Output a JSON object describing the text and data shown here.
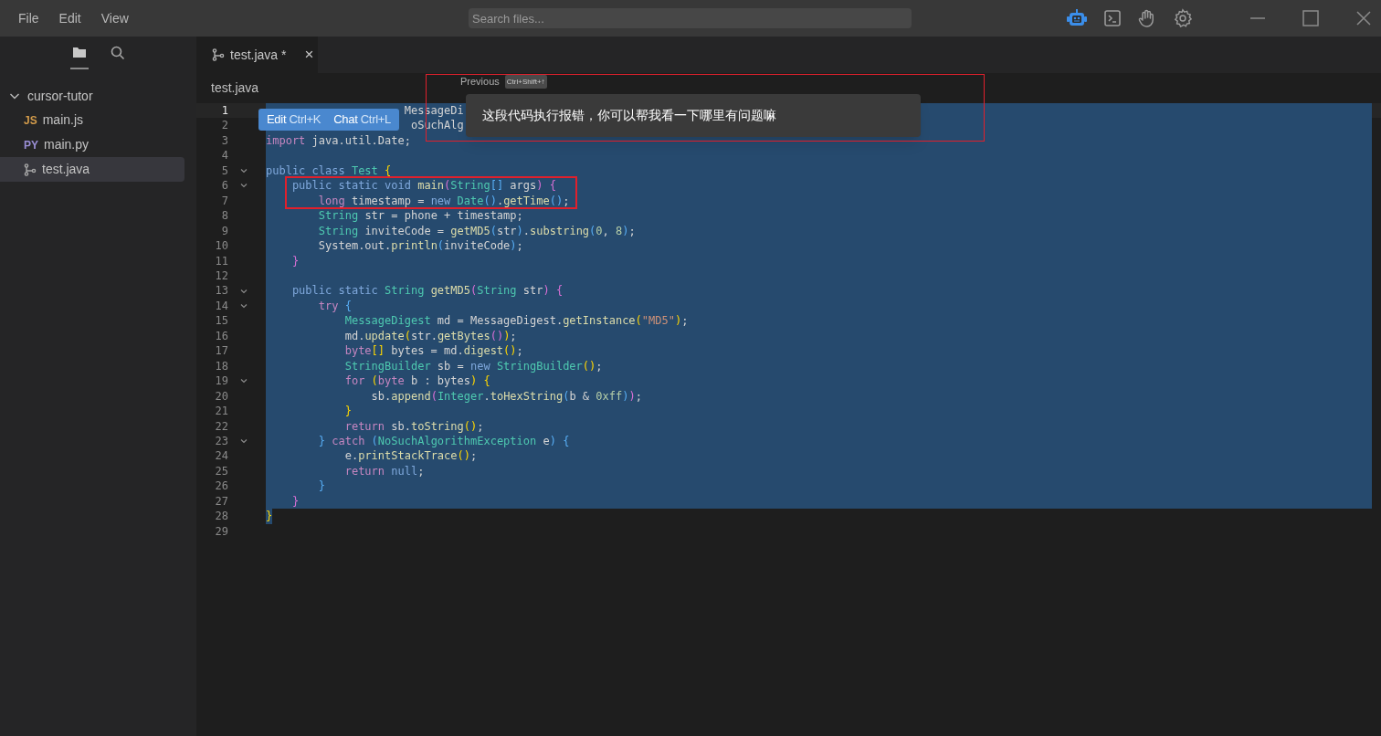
{
  "menu": [
    "File",
    "Edit",
    "View"
  ],
  "search": {
    "placeholder": "Search files..."
  },
  "toolbar": [
    {
      "kind": "robot",
      "selected": true
    },
    {
      "kind": "terminal",
      "selected": false
    },
    {
      "kind": "hand",
      "selected": false
    },
    {
      "kind": "settings",
      "selected": false
    }
  ],
  "sidebar": {
    "tabs": [
      {
        "kind": "files",
        "selected": true
      },
      {
        "kind": "search",
        "selected": false
      }
    ],
    "tree": [
      {
        "name": "cursor-tutor",
        "expanded": true,
        "children": [
          {
            "name": "main.js",
            "kind": "badge",
            "badge": "JS",
            "color": "#d19a4a",
            "selected": false
          },
          {
            "name": "main.py",
            "kind": "badge",
            "badge": "PY",
            "color": "#9a8fd6",
            "selected": false
          },
          {
            "name": "test.java",
            "kind": "java",
            "selected": true
          }
        ]
      }
    ]
  },
  "tab": {
    "label": "test.java *",
    "close": "×"
  },
  "breadcrumb": "test.java",
  "prompt": {
    "previous": "Previous",
    "shortcut": "Ctrl+Shift+↑",
    "value": "这段代码执行报错，你可以帮我看一下哪里有问题嘛"
  },
  "popup": [
    {
      "label": "Edit",
      "shortcut": "Ctrl+K"
    },
    {
      "label": "Chat",
      "shortcut": "Ctrl+L"
    }
  ],
  "lines": [
    {
      "n": "1",
      "active": true,
      "fold": false,
      "selected": true,
      "tokens": [
        {
          "kind": "plain",
          "text": "                     MessageDi"
        }
      ]
    },
    {
      "n": "2",
      "active": false,
      "fold": false,
      "selected": true,
      "tokens": [
        {
          "kind": "plain",
          "text": "                      oSuchAlg"
        }
      ]
    },
    {
      "n": "3",
      "active": false,
      "fold": false,
      "selected": true,
      "tokens": [
        {
          "kind": "keyword",
          "text": "import"
        },
        {
          "kind": "plain",
          "text": " java.util.Date;"
        }
      ]
    },
    {
      "n": "4",
      "active": false,
      "fold": false,
      "selected": true
    },
    {
      "n": "5",
      "active": false,
      "fold": true,
      "selected": true,
      "tokens": [
        {
          "kind": "modifier",
          "text": "public class "
        },
        {
          "kind": "type",
          "text": "Test"
        },
        {
          "kind": "bracket1",
          "text": " {"
        }
      ]
    },
    {
      "n": "6",
      "active": false,
      "fold": true,
      "selected": true,
      "tokens": [
        {
          "kind": "modifier",
          "text": "    public static void "
        },
        {
          "kind": "function",
          "text": "main"
        },
        {
          "kind": "bracket2",
          "text": "("
        },
        {
          "kind": "type",
          "text": "String"
        },
        {
          "kind": "bracket3",
          "text": "[]"
        },
        {
          "kind": "plain",
          "text": " args"
        },
        {
          "kind": "bracket2",
          "text": ")"
        },
        {
          "kind": "bracket2",
          "text": " {"
        }
      ]
    },
    {
      "n": "7",
      "active": false,
      "fold": false,
      "selected": true,
      "tokens": [
        {
          "kind": "keyword",
          "text": "        long"
        },
        {
          "kind": "plain",
          "text": " timestamp = "
        },
        {
          "kind": "modifier",
          "text": "new "
        },
        {
          "kind": "type",
          "text": "Date"
        },
        {
          "kind": "bracket3",
          "text": "()"
        },
        {
          "kind": "plain",
          "text": "."
        },
        {
          "kind": "function",
          "text": "getTime"
        },
        {
          "kind": "bracket3",
          "text": "()"
        },
        {
          "kind": "plain",
          "text": ";"
        }
      ]
    },
    {
      "n": "8",
      "active": false,
      "fold": false,
      "selected": true,
      "tokens": [
        {
          "kind": "type",
          "text": "        String"
        },
        {
          "kind": "plain",
          "text": " str = phone + timestamp;"
        }
      ]
    },
    {
      "n": "9",
      "active": false,
      "fold": false,
      "selected": true,
      "tokens": [
        {
          "kind": "type",
          "text": "        String"
        },
        {
          "kind": "plain",
          "text": " inviteCode = "
        },
        {
          "kind": "function",
          "text": "getMD5"
        },
        {
          "kind": "bracket3",
          "text": "("
        },
        {
          "kind": "plain",
          "text": "str"
        },
        {
          "kind": "bracket3",
          "text": ")"
        },
        {
          "kind": "plain",
          "text": "."
        },
        {
          "kind": "function",
          "text": "substring"
        },
        {
          "kind": "bracket3",
          "text": "("
        },
        {
          "kind": "number",
          "text": "0"
        },
        {
          "kind": "plain",
          "text": ", "
        },
        {
          "kind": "number",
          "text": "8"
        },
        {
          "kind": "bracket3",
          "text": ")"
        },
        {
          "kind": "plain",
          "text": ";"
        }
      ]
    },
    {
      "n": "10",
      "active": false,
      "fold": false,
      "selected": true,
      "tokens": [
        {
          "kind": "plain",
          "text": "        System.out."
        },
        {
          "kind": "function",
          "text": "println"
        },
        {
          "kind": "bracket3",
          "text": "("
        },
        {
          "kind": "plain",
          "text": "inviteCode"
        },
        {
          "kind": "bracket3",
          "text": ")"
        },
        {
          "kind": "plain",
          "text": ";"
        }
      ]
    },
    {
      "n": "11",
      "active": false,
      "fold": false,
      "selected": true,
      "tokens": [
        {
          "kind": "bracket2",
          "text": "    }"
        }
      ]
    },
    {
      "n": "12",
      "active": false,
      "fold": false,
      "selected": true
    },
    {
      "n": "13",
      "active": false,
      "fold": true,
      "selected": true,
      "tokens": [
        {
          "kind": "modifier",
          "text": "    public static "
        },
        {
          "kind": "type",
          "text": "String"
        },
        {
          "kind": "function",
          "text": " getMD5"
        },
        {
          "kind": "bracket2",
          "text": "("
        },
        {
          "kind": "type",
          "text": "String"
        },
        {
          "kind": "plain",
          "text": " str"
        },
        {
          "kind": "bracket2",
          "text": ")"
        },
        {
          "kind": "bracket2",
          "text": " {"
        }
      ]
    },
    {
      "n": "14",
      "active": false,
      "fold": true,
      "selected": true,
      "tokens": [
        {
          "kind": "keyword",
          "text": "        try "
        },
        {
          "kind": "bracket3",
          "text": "{"
        }
      ]
    },
    {
      "n": "15",
      "active": false,
      "fold": false,
      "selected": true,
      "tokens": [
        {
          "kind": "type",
          "text": "            MessageDigest"
        },
        {
          "kind": "plain",
          "text": " md = MessageDigest."
        },
        {
          "kind": "function",
          "text": "getInstance"
        },
        {
          "kind": "bracket1",
          "text": "("
        },
        {
          "kind": "string",
          "text": "\"MD5\""
        },
        {
          "kind": "bracket1",
          "text": ")"
        },
        {
          "kind": "plain",
          "text": ";"
        }
      ]
    },
    {
      "n": "16",
      "active": false,
      "fold": false,
      "selected": true,
      "tokens": [
        {
          "kind": "plain",
          "text": "            md."
        },
        {
          "kind": "function",
          "text": "update"
        },
        {
          "kind": "bracket1",
          "text": "("
        },
        {
          "kind": "plain",
          "text": "str."
        },
        {
          "kind": "function",
          "text": "getBytes"
        },
        {
          "kind": "bracket2",
          "text": "()"
        },
        {
          "kind": "bracket1",
          "text": ")"
        },
        {
          "kind": "plain",
          "text": ";"
        }
      ]
    },
    {
      "n": "17",
      "active": false,
      "fold": false,
      "selected": true,
      "tokens": [
        {
          "kind": "keyword",
          "text": "            byte"
        },
        {
          "kind": "bracket1",
          "text": "[]"
        },
        {
          "kind": "plain",
          "text": " bytes = md."
        },
        {
          "kind": "function",
          "text": "digest"
        },
        {
          "kind": "bracket1",
          "text": "()"
        },
        {
          "kind": "plain",
          "text": ";"
        }
      ]
    },
    {
      "n": "18",
      "active": false,
      "fold": false,
      "selected": true,
      "tokens": [
        {
          "kind": "type",
          "text": "            StringBuilder"
        },
        {
          "kind": "plain",
          "text": " sb = "
        },
        {
          "kind": "modifier",
          "text": "new "
        },
        {
          "kind": "type",
          "text": "StringBuilder"
        },
        {
          "kind": "bracket1",
          "text": "()"
        },
        {
          "kind": "plain",
          "text": ";"
        }
      ]
    },
    {
      "n": "19",
      "active": false,
      "fold": true,
      "selected": true,
      "tokens": [
        {
          "kind": "keyword",
          "text": "            for "
        },
        {
          "kind": "bracket1",
          "text": "("
        },
        {
          "kind": "keyword",
          "text": "byte"
        },
        {
          "kind": "plain",
          "text": " b : bytes"
        },
        {
          "kind": "bracket1",
          "text": ")"
        },
        {
          "kind": "bracket1",
          "text": " {"
        }
      ]
    },
    {
      "n": "20",
      "active": false,
      "fold": false,
      "selected": true,
      "tokens": [
        {
          "kind": "plain",
          "text": "                sb."
        },
        {
          "kind": "function",
          "text": "append"
        },
        {
          "kind": "bracket2",
          "text": "("
        },
        {
          "kind": "type",
          "text": "Integer"
        },
        {
          "kind": "plain",
          "text": "."
        },
        {
          "kind": "function",
          "text": "toHexString"
        },
        {
          "kind": "bracket3",
          "text": "("
        },
        {
          "kind": "plain",
          "text": "b & "
        },
        {
          "kind": "number",
          "text": "0xff"
        },
        {
          "kind": "bracket3",
          "text": ")"
        },
        {
          "kind": "bracket2",
          "text": ")"
        },
        {
          "kind": "plain",
          "text": ";"
        }
      ]
    },
    {
      "n": "21",
      "active": false,
      "fold": false,
      "selected": true,
      "tokens": [
        {
          "kind": "bracket1",
          "text": "            }"
        }
      ]
    },
    {
      "n": "22",
      "active": false,
      "fold": false,
      "selected": true,
      "tokens": [
        {
          "kind": "keyword",
          "text": "            return"
        },
        {
          "kind": "plain",
          "text": " sb."
        },
        {
          "kind": "function",
          "text": "toString"
        },
        {
          "kind": "bracket1",
          "text": "()"
        },
        {
          "kind": "plain",
          "text": ";"
        }
      ]
    },
    {
      "n": "23",
      "active": false,
      "fold": true,
      "selected": true,
      "tokens": [
        {
          "kind": "bracket3",
          "text": "        }"
        },
        {
          "kind": "keyword",
          "text": " catch "
        },
        {
          "kind": "bracket3",
          "text": "("
        },
        {
          "kind": "type",
          "text": "NoSuchAlgorithmException"
        },
        {
          "kind": "plain",
          "text": " e"
        },
        {
          "kind": "bracket3",
          "text": ")"
        },
        {
          "kind": "bracket3",
          "text": " {"
        }
      ]
    },
    {
      "n": "24",
      "active": false,
      "fold": false,
      "selected": true,
      "tokens": [
        {
          "kind": "plain",
          "text": "            e."
        },
        {
          "kind": "function",
          "text": "printStackTrace"
        },
        {
          "kind": "bracket1",
          "text": "()"
        },
        {
          "kind": "plain",
          "text": ";"
        }
      ]
    },
    {
      "n": "25",
      "active": false,
      "fold": false,
      "selected": true,
      "tokens": [
        {
          "kind": "keyword",
          "text": "            return "
        },
        {
          "kind": "modifier",
          "text": "null"
        },
        {
          "kind": "plain",
          "text": ";"
        }
      ]
    },
    {
      "n": "26",
      "active": false,
      "fold": false,
      "selected": true,
      "tokens": [
        {
          "kind": "bracket3",
          "text": "        }"
        }
      ]
    },
    {
      "n": "27",
      "active": false,
      "fold": false,
      "selected": true,
      "tokens": [
        {
          "kind": "bracket2",
          "text": "    }"
        }
      ]
    },
    {
      "n": "28",
      "active": false,
      "fold": false,
      "selected": false,
      "tokens": [
        {
          "kind": "bracket1",
          "text": "}"
        }
      ]
    },
    {
      "n": "29",
      "active": false,
      "fold": false
    }
  ]
}
